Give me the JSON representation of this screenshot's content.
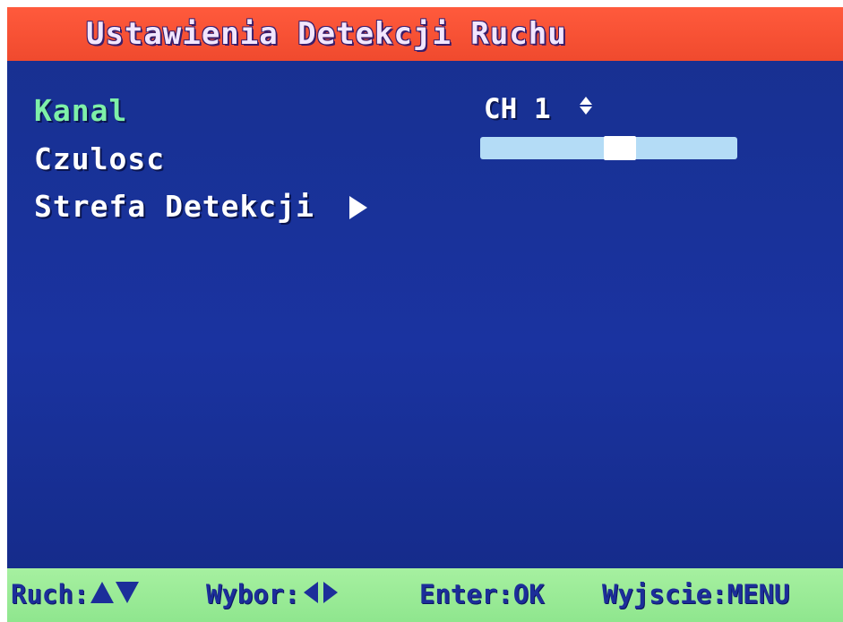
{
  "header": {
    "title": "Ustawienia Detekcji Ruchu"
  },
  "menu": {
    "items": [
      {
        "label": "Kanal",
        "selected": true
      },
      {
        "label": "Czulosc"
      },
      {
        "label": "Strefa Detekcji"
      }
    ]
  },
  "channel": {
    "value": "CH 1"
  },
  "sensitivity": {
    "level": 0.55
  },
  "footer": {
    "move_label": "Ruch:",
    "select_label": "Wybor:",
    "enter_label": "Enter:OK",
    "exit_label": "Wyjscie:MENU"
  },
  "colors": {
    "background": "#1a33a0",
    "title_bar": "#f04a2e",
    "footer_bar": "#8fe68e",
    "selected_text": "#7ef0a8",
    "slider_track": "#b4dcf6"
  },
  "icons": {
    "submenu": "arrow-right-icon",
    "channel_select": "updown-icon",
    "move": [
      "arrow-up-icon",
      "arrow-down-icon"
    ],
    "select": [
      "arrow-left-icon",
      "arrow-right-icon"
    ]
  }
}
